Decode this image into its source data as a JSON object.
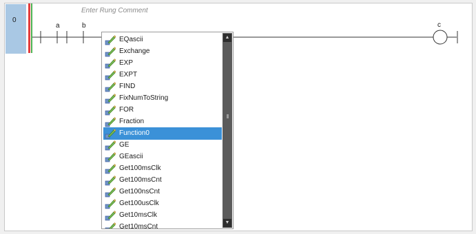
{
  "rung": {
    "number": "0",
    "comment_placeholder": "Enter Rung Comment",
    "contacts": [
      {
        "label": "a"
      },
      {
        "label": "b"
      }
    ],
    "coil": {
      "label": "c"
    }
  },
  "dropdown": {
    "items": [
      {
        "label": "EQascii",
        "selected": false
      },
      {
        "label": "Exchange",
        "selected": false
      },
      {
        "label": "EXP",
        "selected": false
      },
      {
        "label": "EXPT",
        "selected": false
      },
      {
        "label": "FIND",
        "selected": false
      },
      {
        "label": "FixNumToString",
        "selected": false
      },
      {
        "label": "FOR",
        "selected": false
      },
      {
        "label": "Fraction",
        "selected": false
      },
      {
        "label": "Function0",
        "selected": true
      },
      {
        "label": "GE",
        "selected": false
      },
      {
        "label": "GEascii",
        "selected": false
      },
      {
        "label": "Get100msClk",
        "selected": false
      },
      {
        "label": "Get100msCnt",
        "selected": false
      },
      {
        "label": "Get100nsCnt",
        "selected": false
      },
      {
        "label": "Get100usClk",
        "selected": false
      },
      {
        "label": "Get10msClk",
        "selected": false
      },
      {
        "label": "Get10msCnt",
        "selected": false
      }
    ]
  },
  "colors": {
    "gutter": "#a9c8e4",
    "rail_red": "#e33b3b",
    "rail_green": "#4cb050",
    "selection": "#3b91d8"
  }
}
